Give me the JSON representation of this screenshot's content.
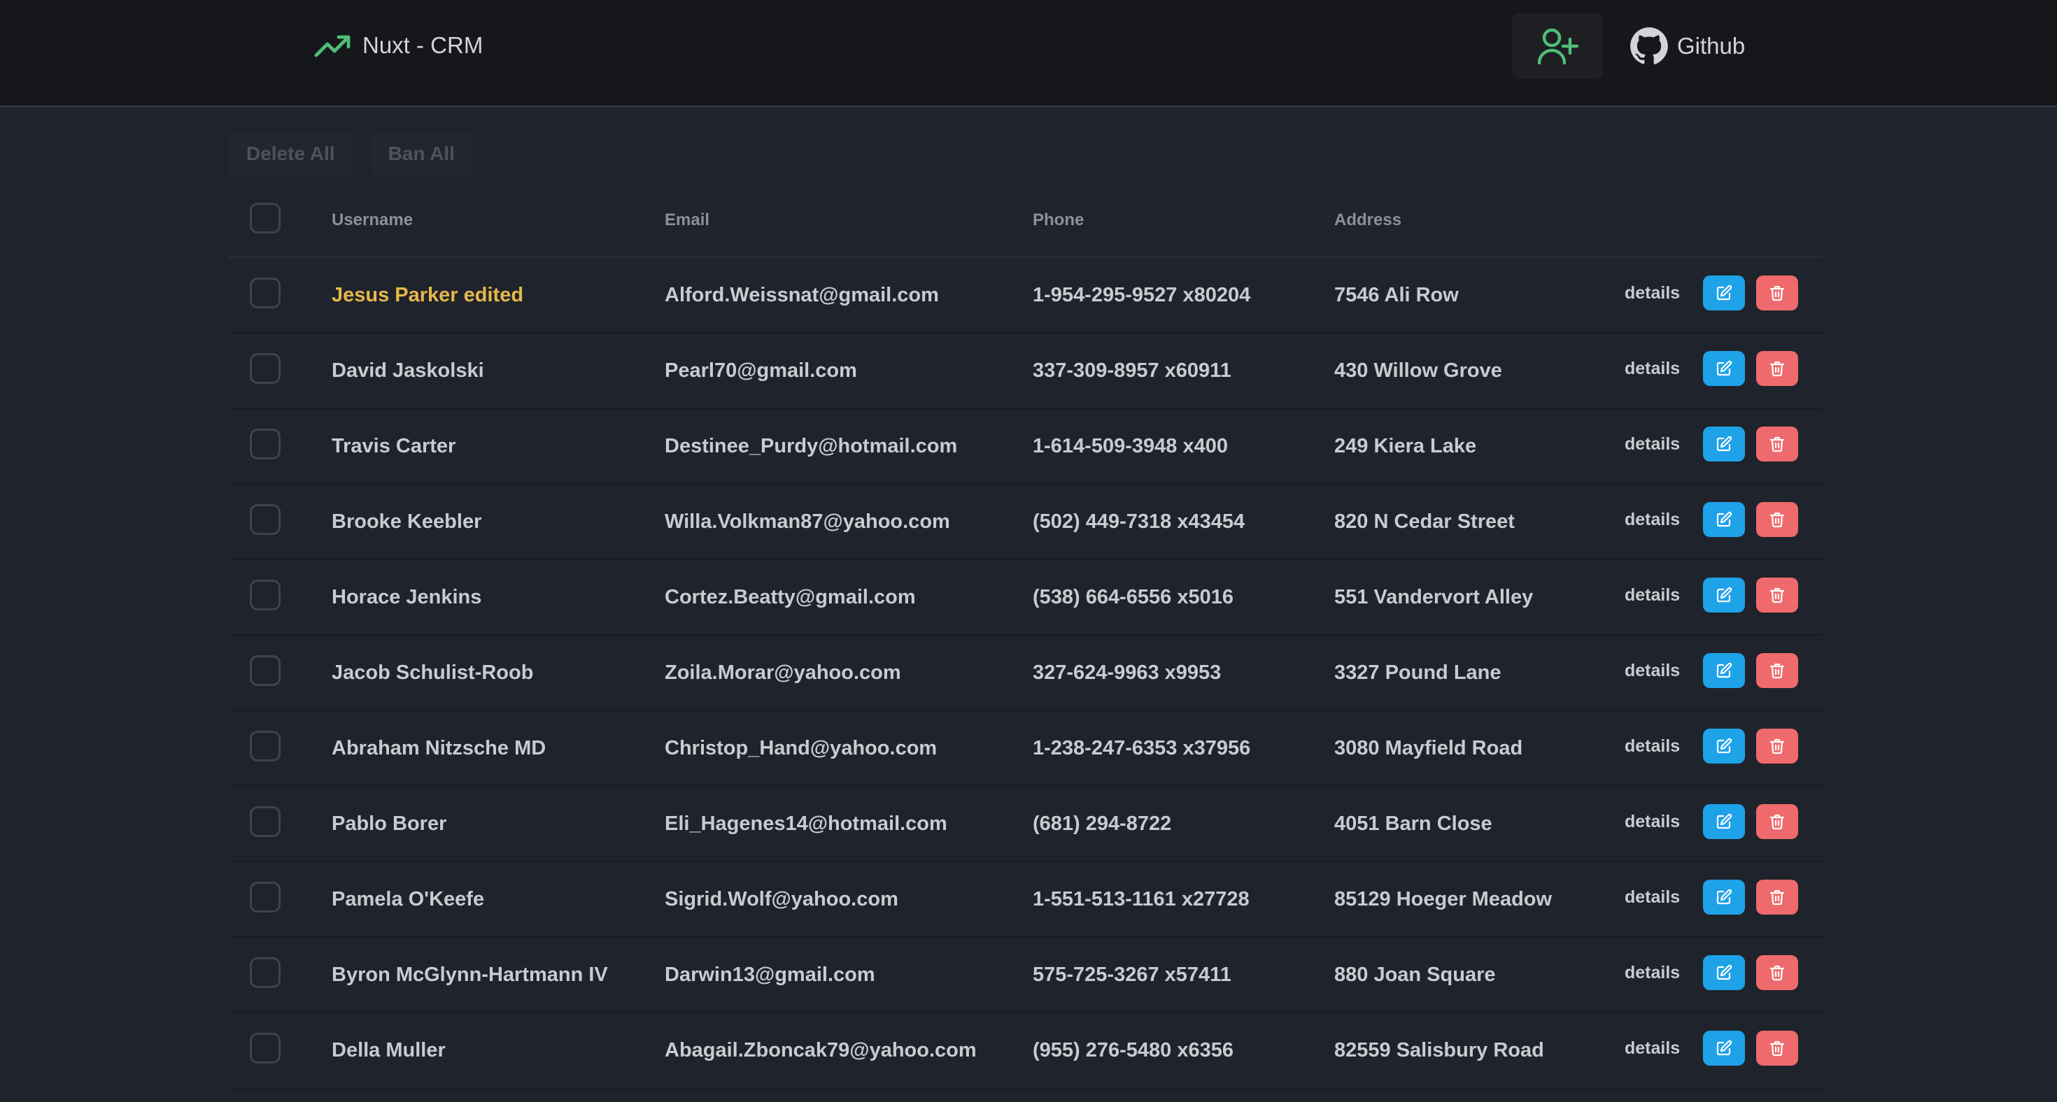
{
  "header": {
    "brand": "Nuxt - CRM",
    "github_label": "Github"
  },
  "bulk": {
    "delete_all": "Delete All",
    "ban_all": "Ban All"
  },
  "table": {
    "columns": {
      "username": "Username",
      "email": "Email",
      "phone": "Phone",
      "address": "Address"
    },
    "details_label": "details",
    "rows": [
      {
        "username": "Jesus Parker edited",
        "email": "Alford.Weissnat@gmail.com",
        "phone": "1-954-295-9527 x80204",
        "address": "7546 Ali Row",
        "highlight": true
      },
      {
        "username": "David Jaskolski",
        "email": "Pearl70@gmail.com",
        "phone": "337-309-8957 x60911",
        "address": "430 Willow Grove"
      },
      {
        "username": "Travis Carter",
        "email": "Destinee_Purdy@hotmail.com",
        "phone": "1-614-509-3948 x400",
        "address": "249 Kiera Lake"
      },
      {
        "username": "Brooke Keebler",
        "email": "Willa.Volkman87@yahoo.com",
        "phone": "(502) 449-7318 x43454",
        "address": "820 N Cedar Street"
      },
      {
        "username": "Horace Jenkins",
        "email": "Cortez.Beatty@gmail.com",
        "phone": "(538) 664-6556 x5016",
        "address": "551 Vandervort Alley"
      },
      {
        "username": "Jacob Schulist-Roob",
        "email": "Zoila.Morar@yahoo.com",
        "phone": "327-624-9963 x9953",
        "address": "3327 Pound Lane"
      },
      {
        "username": "Abraham Nitzsche MD",
        "email": "Christop_Hand@yahoo.com",
        "phone": "1-238-247-6353 x37956",
        "address": "3080 Mayfield Road"
      },
      {
        "username": "Pablo Borer",
        "email": "Eli_Hagenes14@hotmail.com",
        "phone": "(681) 294-8722",
        "address": "4051 Barn Close"
      },
      {
        "username": "Pamela O'Keefe",
        "email": "Sigrid.Wolf@yahoo.com",
        "phone": "1-551-513-1161 x27728",
        "address": "85129 Hoeger Meadow"
      },
      {
        "username": "Byron McGlynn-Hartmann IV",
        "email": "Darwin13@gmail.com",
        "phone": "575-725-3267 x57411",
        "address": "880 Joan Square"
      },
      {
        "username": "Della Muller",
        "email": "Abagail.Zboncak79@yahoo.com",
        "phone": "(955) 276-5480 x6356",
        "address": "82559 Salisbury Road"
      }
    ]
  },
  "icons": {
    "brand": "trending-up-icon",
    "add_user": "user-plus-icon",
    "github": "github-icon",
    "edit": "edit-icon",
    "delete": "trash-icon"
  },
  "colors": {
    "accent_green": "#4fbe79",
    "edit_blue": "#1ea2e8",
    "delete_red": "#ef6a6c",
    "highlight_yellow": "#e6b84a"
  }
}
